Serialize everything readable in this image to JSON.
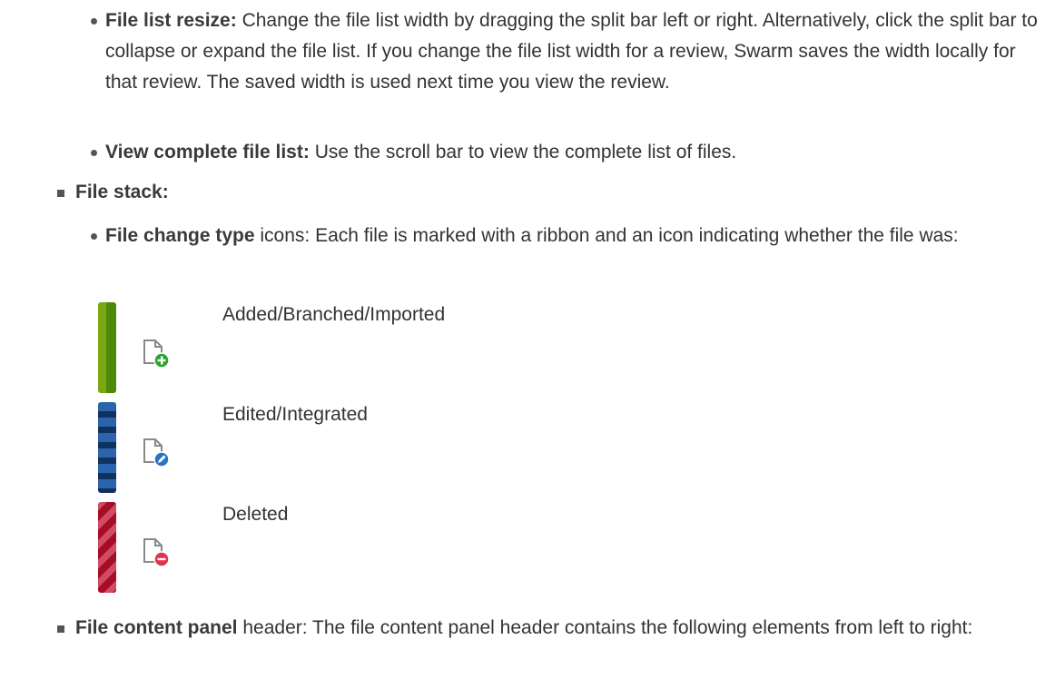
{
  "items": {
    "file_list_resize": {
      "term": "File list resize:",
      "text": " Change the file list width by dragging the split bar left or right. Alternatively, click the split bar to collapse or expand the file list. If you change the file list width for a review, Swarm saves the width locally for that review. The saved width is used next time you view the review."
    },
    "view_complete": {
      "term": "View complete file list:",
      "text": " Use the scroll bar to view the complete list of files."
    },
    "file_stack": {
      "term": "File stack:"
    },
    "file_change_type": {
      "term": "File change type",
      "text": " icons: Each file is marked with a ribbon and an icon indicating whether the file was:"
    },
    "file_content_panel": {
      "term": "File content panel",
      "text": " header: The file content panel header contains the following elements from left to right:"
    }
  },
  "legend": [
    {
      "label": "Added/Branched/Imported",
      "ribbon": "striped-green",
      "icon": "file-add-icon",
      "color": "#2aa52a"
    },
    {
      "label": "Edited/Integrated",
      "ribbon": "striped-blue",
      "icon": "file-edit-icon",
      "color": "#2b73c4"
    },
    {
      "label": "Deleted",
      "ribbon": "striped-red",
      "icon": "file-delete-icon",
      "color": "#e0334d"
    }
  ]
}
